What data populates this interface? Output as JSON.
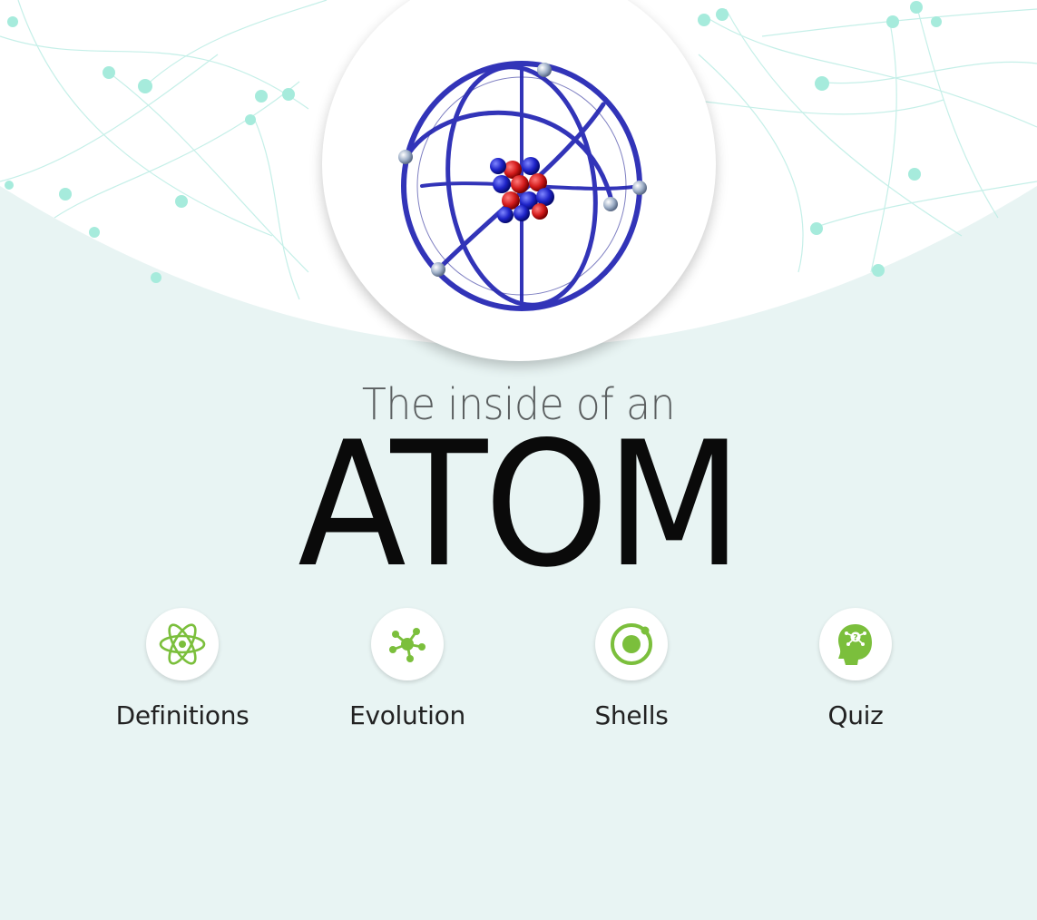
{
  "subtitle": "The inside of an",
  "title": "ATOM",
  "colors": {
    "background": "#e8f4f3",
    "accent": "#7bbf3c",
    "orbit": "#3a3bbf",
    "proton": "#d42020",
    "neutron": "#1f22c8"
  },
  "hero": {
    "icon": "atom-model-icon"
  },
  "menu": [
    {
      "label": "Definitions",
      "icon": "atom-icon"
    },
    {
      "label": "Evolution",
      "icon": "molecule-icon"
    },
    {
      "label": "Shells",
      "icon": "shell-ring-icon"
    },
    {
      "label": "Quiz",
      "icon": "head-question-icon"
    }
  ]
}
